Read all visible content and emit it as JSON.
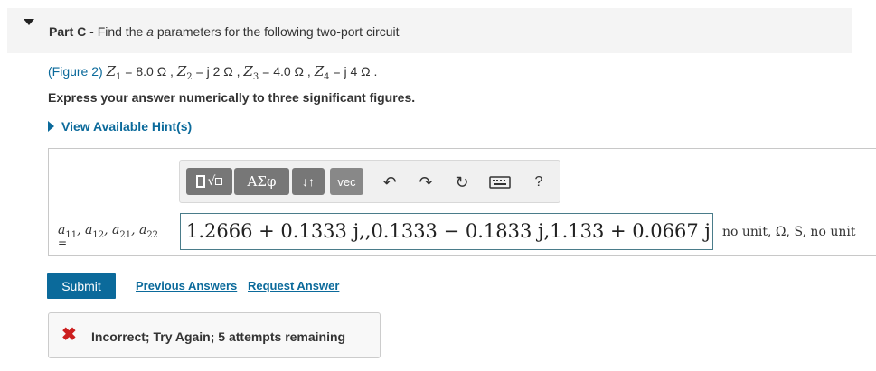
{
  "part": {
    "label": "Part C",
    "separator": " - ",
    "title_before": "Find the ",
    "title_italic": "a",
    "title_after": " parameters for the following two-port circuit"
  },
  "problem": {
    "figure_link": "(Figure 2)",
    "z1": "Z",
    "z1_sub": "1",
    "z1_value": " = 8.0 Ω , ",
    "z2": "Z",
    "z2_sub": "2",
    "z2_value": " = j 2 Ω , ",
    "z3": "Z",
    "z3_sub": "3",
    "z3_value": " = 4.0 Ω , ",
    "z4": "Z",
    "z4_sub": "4",
    "z4_value": " = j 4 Ω ."
  },
  "instruction": "Express your answer numerically to three significant figures.",
  "hint_label": "View Available Hint(s)",
  "toolbar": {
    "greek_label": "ΑΣφ",
    "arrows_label": "↓↑",
    "vec_label": "vec",
    "undo_icon": "↶",
    "redo_icon": "↷",
    "reset_icon": "↻",
    "help_label": "?"
  },
  "answer": {
    "variables_label": "a11, a12, a21, a22",
    "equals": "=",
    "value": "1.2666 + 0.1333 j,,0.1333 − 0.1833 j,1.133 + 0.0667 j",
    "units": "no unit, Ω, S, no unit"
  },
  "actions": {
    "submit": "Submit",
    "previous_answers": "Previous Answers",
    "request_answer": "Request Answer"
  },
  "feedback": {
    "icon": "✖",
    "message": "Incorrect; Try Again; 5 attempts remaining",
    "status_color": "#cc1f1f"
  },
  "colors": {
    "accent": "#0b6a9b",
    "header_bg": "#f4f4f4",
    "toolbar_button": "#777777"
  }
}
